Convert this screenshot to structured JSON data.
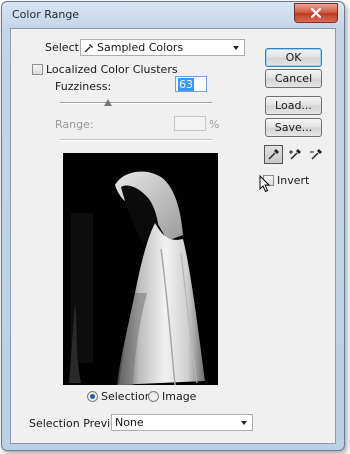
{
  "window": {
    "title": "Color Range"
  },
  "select": {
    "label": "Select:",
    "value": "Sampled Colors"
  },
  "localized_clusters": {
    "label": "Localized Color Clusters",
    "checked": false
  },
  "fuzziness": {
    "label": "Fuzziness:",
    "value": "63",
    "slider_value": 63,
    "slider_max": 200
  },
  "range": {
    "label": "Range:",
    "value": "",
    "unit": "%"
  },
  "preview_mode": {
    "options": [
      "Selection",
      "Image"
    ],
    "selected": "Selection"
  },
  "selection_preview": {
    "label": "Selection Preview:",
    "value": "None"
  },
  "buttons": {
    "ok": "OK",
    "cancel": "Cancel",
    "load": "Load...",
    "save": "Save..."
  },
  "eyedroppers": [
    "eyedropper-icon",
    "eyedropper-plus-icon",
    "eyedropper-minus-icon"
  ],
  "invert": {
    "label": "Invert",
    "checked": false
  },
  "colors": {
    "title_bar": "#c5d5e8",
    "close_button": "#c0391f",
    "dialog_bg": "#f0f0f0",
    "preview_bg": "#000000"
  }
}
